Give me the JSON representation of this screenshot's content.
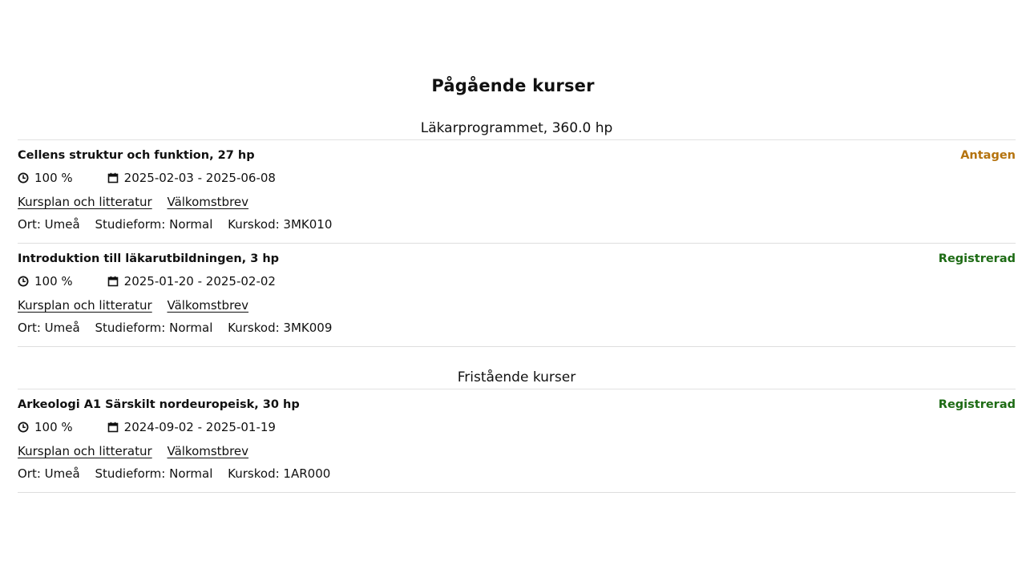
{
  "page_title": "Pågående kurser",
  "groups": [
    {
      "heading": "Läkarprogrammet, 360.0 hp",
      "courses": [
        {
          "title": "Cellens struktur och funktion, 27 hp",
          "status": "Antagen",
          "pace": "100 %",
          "dates": "2025-02-03 - 2025-06-08",
          "link_syllabus": "Kursplan och litteratur",
          "link_welcome": "Välkomstbrev",
          "location": "Ort: Umeå",
          "study_form": "Studieform: Normal",
          "course_code": "Kurskod: 3MK010"
        },
        {
          "title": "Introduktion till läkarutbildningen, 3 hp",
          "status": "Registrerad",
          "pace": "100 %",
          "dates": "2025-01-20 - 2025-02-02",
          "link_syllabus": "Kursplan och litteratur",
          "link_welcome": "Välkomstbrev",
          "location": "Ort: Umeå",
          "study_form": "Studieform: Normal",
          "course_code": "Kurskod: 3MK009"
        }
      ]
    },
    {
      "heading": "Fristående kurser",
      "courses": [
        {
          "title": "Arkeologi A1 Särskilt nordeuropeisk, 30 hp",
          "status": "Registrerad",
          "pace": "100 %",
          "dates": "2024-09-02 - 2025-01-19",
          "link_syllabus": "Kursplan och litteratur",
          "link_welcome": "Välkomstbrev",
          "location": "Ort: Umeå",
          "study_form": "Studieform: Normal",
          "course_code": "Kurskod: 1AR000"
        }
      ]
    }
  ],
  "colors": {
    "status_antagen": "#b5730e",
    "status_registrerad": "#1d6b14"
  },
  "icons": {
    "pace": "clock-icon",
    "dates": "calendar-icon"
  }
}
